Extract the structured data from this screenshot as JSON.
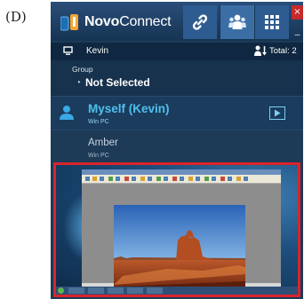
{
  "figure_label": "(D)",
  "app": {
    "title_bold": "Novo",
    "title_rest": "Connect",
    "brand_color": "#f3a633",
    "toolbar": [
      {
        "icon": "link-icon"
      },
      {
        "icon": "users-icon"
      },
      {
        "icon": "grid-icon"
      }
    ],
    "close_glyph": "×",
    "minimize_glyph": "_"
  },
  "user_bar": {
    "device_icon": "monitor-icon",
    "name": "Kevin",
    "count_icon": "person-sort-icon",
    "total": "Total: 2"
  },
  "group": {
    "label": "Group",
    "value": "Not Selected",
    "arrow": "‣"
  },
  "participants": [
    {
      "name": "Myself (Kevin)",
      "subtitle": "Win PC",
      "highlighted": true,
      "accent": "#4fc0ef",
      "icon": "person-icon",
      "action_icon": "presentation-icon"
    },
    {
      "name": "Amber",
      "subtitle": "Win PC",
      "highlighted": false
    }
  ],
  "preview": {
    "border_color": "#d9242a",
    "description_icon": "screen-preview"
  }
}
